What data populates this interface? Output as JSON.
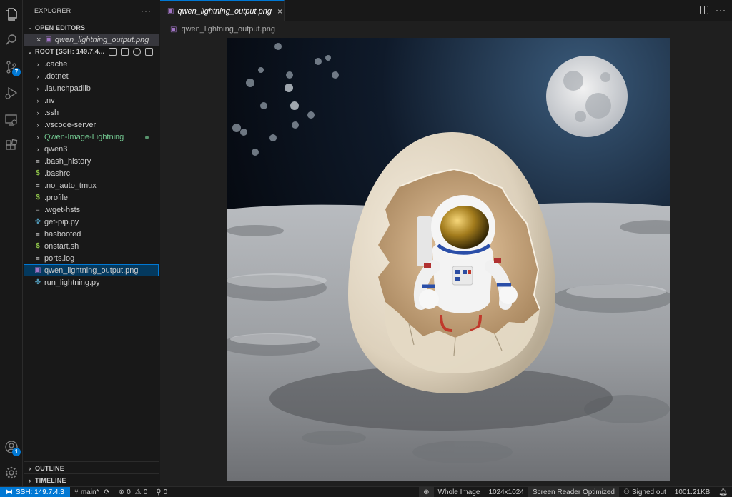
{
  "activity_bar": {
    "source_control_badge": "7",
    "accounts_badge": "1"
  },
  "sidebar": {
    "title": "EXPLORER",
    "more": "···",
    "open_editors_title": "OPEN EDITORS",
    "open_editor_file": "qwen_lightning_output.png",
    "root_title": "ROOT [SSH: 149.7.4...",
    "items": [
      {
        "label": ".cache",
        "type": "folder"
      },
      {
        "label": ".dotnet",
        "type": "folder"
      },
      {
        "label": ".launchpadlib",
        "type": "folder"
      },
      {
        "label": ".nv",
        "type": "folder"
      },
      {
        "label": ".ssh",
        "type": "folder"
      },
      {
        "label": ".vscode-server",
        "type": "folder"
      },
      {
        "label": "Qwen-Image-Lightning",
        "type": "folder"
      },
      {
        "label": "qwen3",
        "type": "folder"
      },
      {
        "label": ".bash_history",
        "type": "text"
      },
      {
        "label": ".bashrc",
        "type": "shell"
      },
      {
        "label": ".no_auto_tmux",
        "type": "text"
      },
      {
        "label": ".profile",
        "type": "shell"
      },
      {
        "label": ".wget-hsts",
        "type": "text"
      },
      {
        "label": "get-pip.py",
        "type": "python"
      },
      {
        "label": "hasbooted",
        "type": "text"
      },
      {
        "label": "onstart.sh",
        "type": "shell"
      },
      {
        "label": "ports.log",
        "type": "text"
      },
      {
        "label": "qwen_lightning_output.png",
        "type": "image"
      },
      {
        "label": "run_lightning.py",
        "type": "python"
      }
    ],
    "outline_title": "OUTLINE",
    "timeline_title": "TIMELINE"
  },
  "editor": {
    "tab_label": "qwen_lightning_output.png",
    "tab_close": "×",
    "breadcrumb": "qwen_lightning_output.png"
  },
  "statusbar": {
    "remote": "SSH: 149.7.4.3",
    "branch": "main*",
    "errors": "0",
    "warnings": "0",
    "ports": "0",
    "zoom_mode": "Whole Image",
    "dimensions": "1024x1024",
    "screen_reader": "Screen Reader Optimized",
    "signed_out": "Signed out",
    "file_size": "1001.21KB"
  },
  "colors": {
    "accent": "#0078d4",
    "git_untracked": "#73c991",
    "selection": "#04395e"
  }
}
